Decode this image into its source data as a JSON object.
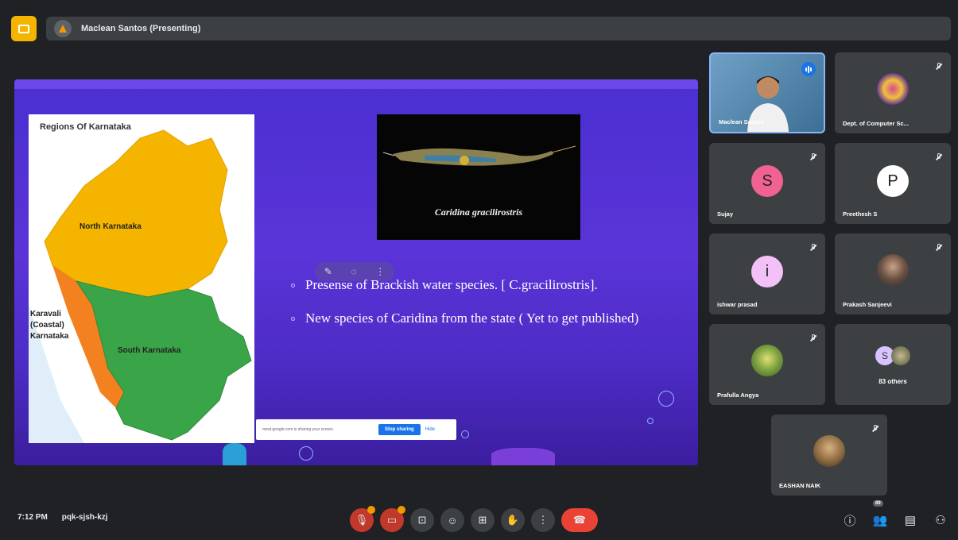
{
  "header": {
    "presenter_label": "Maclean Santos (Presenting)"
  },
  "slide": {
    "map": {
      "title": "Regions Of Karnataka",
      "labels": {
        "north": "North Karnataka",
        "coastal_1": "Karavali",
        "coastal_2": "(Coastal)",
        "coastal_3": "Karnataka",
        "south": "South Karnataka"
      }
    },
    "photo_caption": "Caridina gracilirostris",
    "bullets": [
      "Presense of Brackish water species. [ C.gracilirostris].",
      "New species of Caridina from the state ( Yet to get published)"
    ],
    "share_banner": {
      "message": "meet.google.com is sharing your screen.",
      "stop_label": "Stop sharing",
      "hide_label": "Hide"
    }
  },
  "participants": [
    {
      "name": "Maclean Santos",
      "type": "video"
    },
    {
      "name": "Dept. of Computer Sc...",
      "type": "photo"
    },
    {
      "name": "Sujay",
      "type": "letter",
      "letter": "S",
      "color": "#f06292"
    },
    {
      "name": "Preethesh S",
      "type": "letter",
      "letter": "P",
      "color": "#ffffff"
    },
    {
      "name": "ishwar prasad",
      "type": "letter",
      "letter": "i",
      "color": "#f3c1f7"
    },
    {
      "name": "Prakash Sanjeevi",
      "type": "photo"
    },
    {
      "name": "Prafulla Angya",
      "type": "photo"
    },
    {
      "name": "83 others",
      "type": "others",
      "letter": "S"
    },
    {
      "name": "EASHAN NAIK",
      "type": "photo"
    }
  ],
  "bottom": {
    "time": "7:12 PM",
    "meeting_code": "pqk-sjsh-kzj",
    "people_count": "89"
  },
  "colors": {
    "accent": "#1a73e8",
    "end_call": "#ea4335",
    "slide_bg": "#4a2fd0"
  }
}
